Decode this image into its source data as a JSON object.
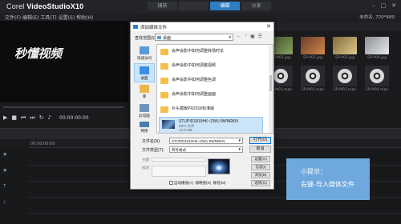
{
  "app": {
    "brand_prefix": "Corel",
    "brand_name": "VideoStudioX10",
    "steps": [
      "捕获",
      "编辑",
      "分享"
    ],
    "menu_text": "文件(F)  编辑(E)  工具(T)  设置(S)  帮助(H)",
    "project_info": "未命名, 720*480",
    "watermark": "秒懂视频",
    "timecode": "00:00:00:00"
  },
  "dialog": {
    "title": "添加媒体文件",
    "look_in_label": "查找范围(I):",
    "look_in_value": "桌面",
    "places": [
      "快速访问",
      "桌面",
      "库",
      "此电脑",
      "网络"
    ],
    "files": [
      "会声会影中如何调整转场时长",
      "会声会影中如何调整视频",
      "会声会影中如何调整色调",
      "会声会影中如何调整画面",
      "片头模板PR2018标准版"
    ],
    "selected_file": {
      "name": "STUPID1819HK~ZWU 8WNRKN",
      "sub1": "MP4 文件",
      "sub2": "14.9 MB"
    },
    "filename_label": "文件名(N):",
    "filename_value": "STUPID1819HK~ZWU 8WNRKN",
    "filetype_label": "文件类型(T):",
    "filetype_value": "所有格式",
    "open_button": "打开(O)",
    "cancel_button": "取消",
    "side_buttons": [
      "设置(G)",
      "信息(I)",
      "浏览(B)",
      "选项(O)"
    ],
    "prop_fields": [
      "主题:",
      "描述:"
    ],
    "autoplay_label": "自动播放(A)",
    "other_buttons": [
      "缩略图(R)",
      "静音(M)"
    ]
  },
  "tip": {
    "line1": "小提示：",
    "line2": "右键-导入媒体文件"
  },
  "library": {
    "thumb_labels": [
      "SP-V01.jpg",
      "SP-V02.jpg",
      "SP-V03.jpg",
      "SP-V04.jpg",
      "SP-M01.mpa",
      "SP-M02.mpa",
      "SP-M03.mpa",
      "SP-M04.mpa"
    ]
  },
  "timeline": {
    "ruler_start": "00:00:00:00"
  }
}
